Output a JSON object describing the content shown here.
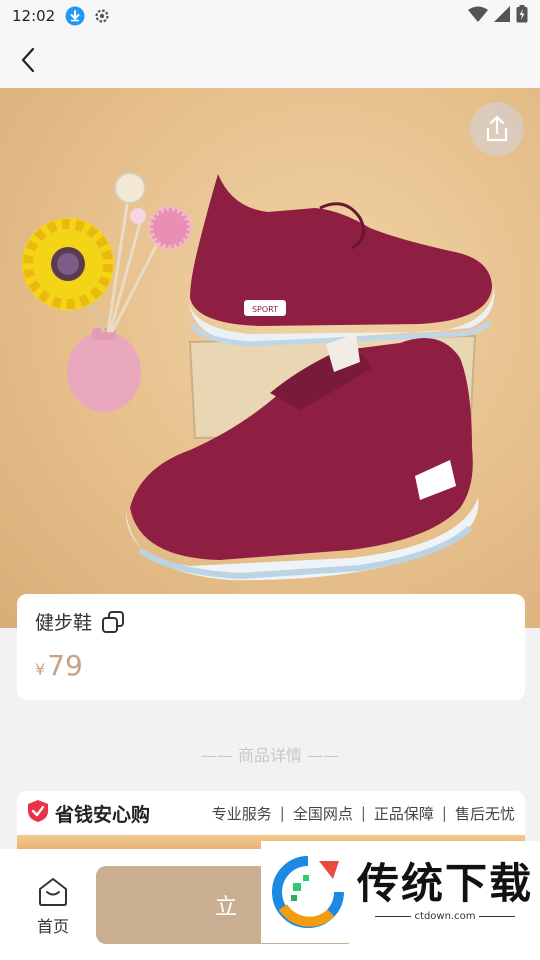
{
  "status_bar": {
    "time": "12:02",
    "icons_left": [
      "download-icon",
      "settings-icon"
    ],
    "icons_right": [
      "wifi-icon",
      "signal-icon",
      "battery-icon"
    ]
  },
  "nav": {
    "back_icon": "chevron-left-icon"
  },
  "hero": {
    "image_description": "product-photo",
    "share_icon": "share-icon",
    "shoe_brand_text": "SPORT"
  },
  "product": {
    "name": "健步鞋",
    "price_symbol": "¥",
    "price": "79",
    "copy_icon": "copy-icon"
  },
  "details": {
    "divider_text": "—— 商品详情 ——"
  },
  "promo": {
    "title": "省钱安心购",
    "tags": [
      "专业服务",
      "全国网点",
      "正品保障",
      "售后无忧"
    ],
    "separator": "|"
  },
  "bottom_bar": {
    "home_label": "首页",
    "buy_label": "立"
  },
  "watermark": {
    "title": "传统下载",
    "url": "ctdown.com"
  },
  "colors": {
    "accent_price": "#c6a383",
    "buy_button": "#c9ae92",
    "shield_red": "#e8334a",
    "background": "#f2f2f2"
  }
}
